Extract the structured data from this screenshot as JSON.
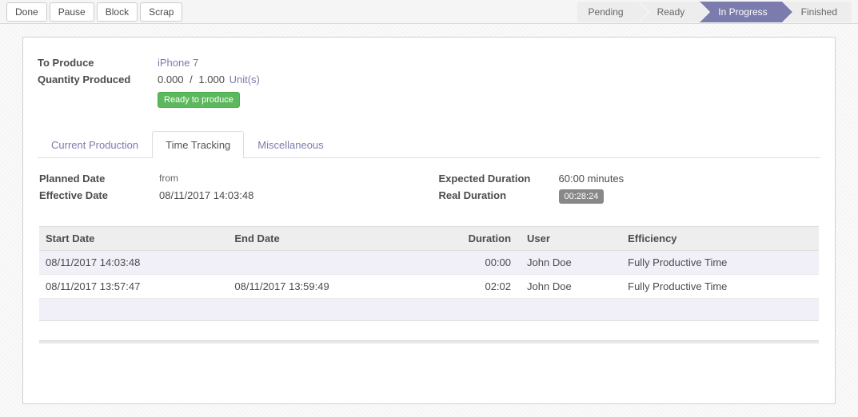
{
  "toolbar": {
    "done": "Done",
    "pause": "Pause",
    "block": "Block",
    "scrap": "Scrap"
  },
  "status": {
    "steps": [
      "Pending",
      "Ready",
      "In Progress",
      "Finished"
    ],
    "active_index": 2
  },
  "header": {
    "to_produce_label": "To Produce",
    "to_produce_value": "iPhone 7",
    "qty_label": "Quantity Produced",
    "qty_done": "0.000",
    "qty_total": "1.000",
    "unit": "Unit(s)",
    "badge": "Ready to produce"
  },
  "tabs": {
    "items": [
      "Current Production",
      "Time Tracking",
      "Miscellaneous"
    ],
    "active_index": 1
  },
  "time_tracking": {
    "planned_date_label": "Planned Date",
    "planned_from_label": "from",
    "effective_date_label": "Effective Date",
    "effective_date": "08/11/2017 14:03:48",
    "expected_duration_label": "Expected Duration",
    "expected_duration": "60:00 minutes",
    "real_duration_label": "Real Duration",
    "real_duration": "00:28:24",
    "columns": [
      "Start Date",
      "End Date",
      "Duration",
      "User",
      "Efficiency"
    ],
    "rows": [
      {
        "start": "08/11/2017 14:03:48",
        "end": "",
        "duration": "00:00",
        "user": "John Doe",
        "efficiency": "Fully Productive Time"
      },
      {
        "start": "08/11/2017 13:57:47",
        "end": "08/11/2017 13:59:49",
        "duration": "02:02",
        "user": "John Doe",
        "efficiency": "Fully Productive Time"
      }
    ]
  }
}
